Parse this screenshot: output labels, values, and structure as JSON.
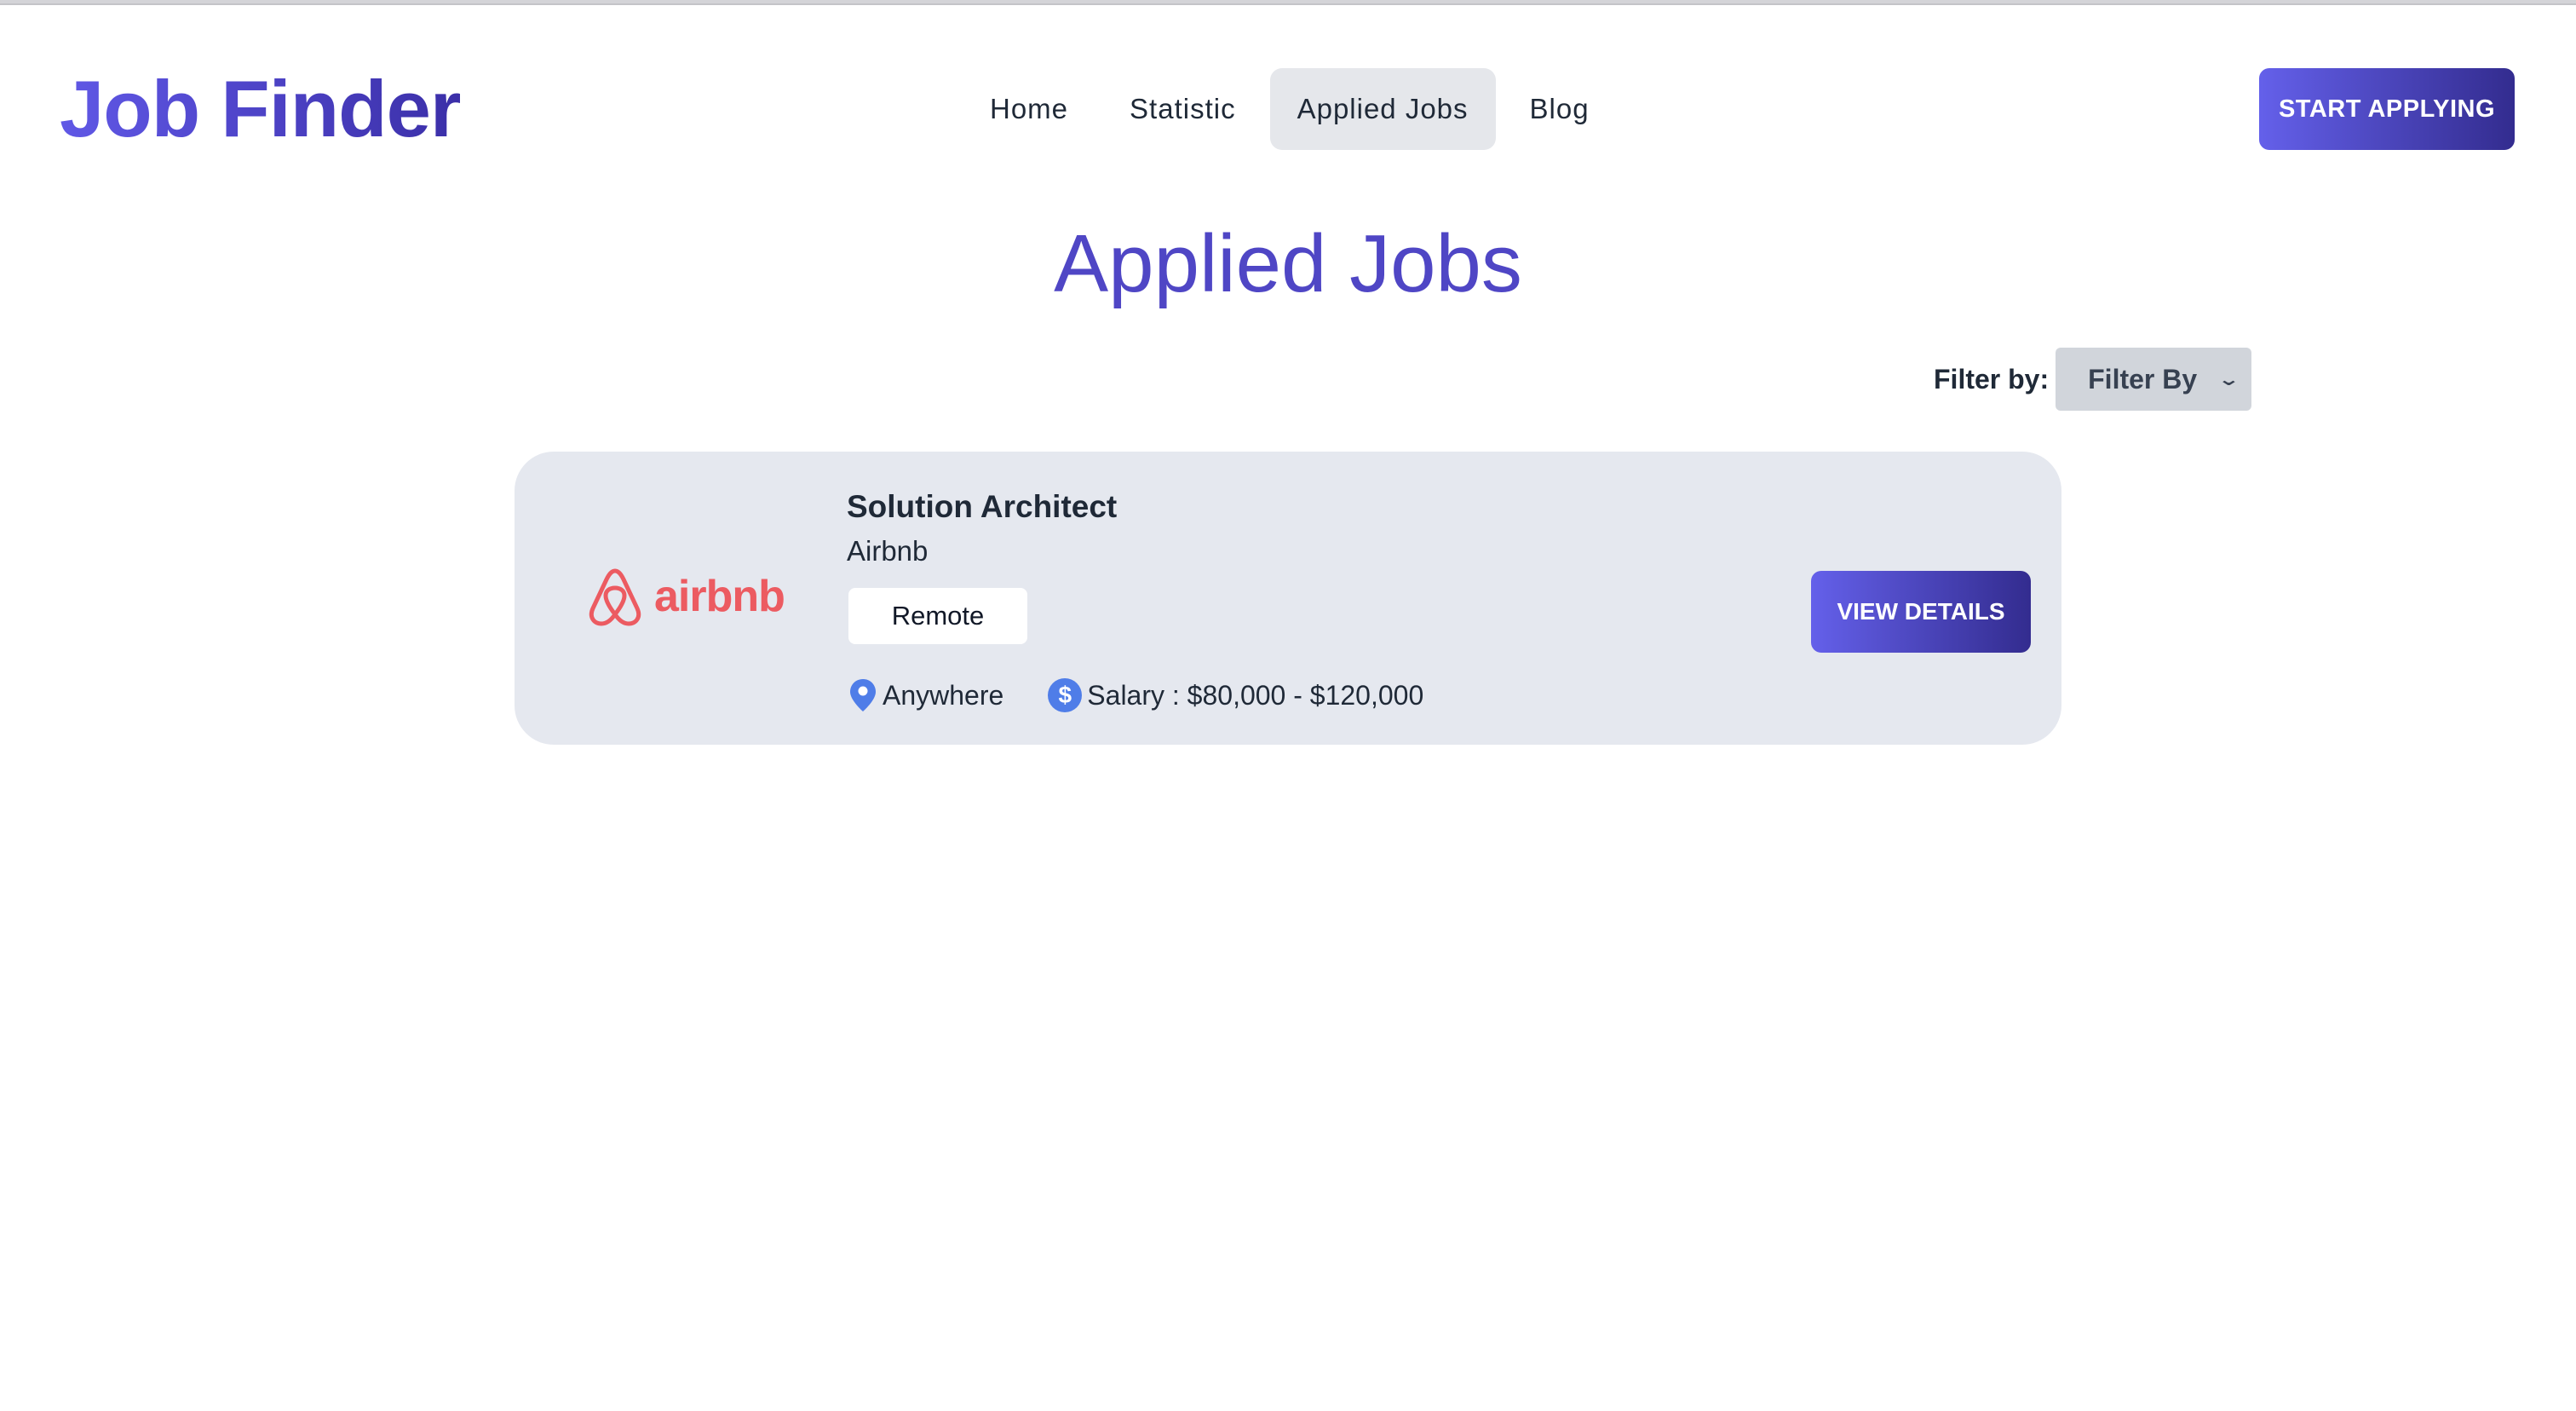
{
  "header": {
    "logo": "Job Finder",
    "nav": [
      {
        "label": "Home"
      },
      {
        "label": "Statistic"
      },
      {
        "label": "Applied Jobs",
        "active": true
      },
      {
        "label": "Blog"
      }
    ],
    "cta_label": "START APPLYING"
  },
  "main": {
    "title": "Applied Jobs",
    "filter": {
      "label": "Filter by:",
      "selected": "Filter By"
    },
    "jobs": [
      {
        "company_logo": "airbnb",
        "title": "Solution Architect",
        "company": "Airbnb",
        "type": "Remote",
        "location": "Anywhere",
        "salary": "Salary : $80,000 - $120,000",
        "button_label": "VIEW DETAILS"
      }
    ]
  },
  "icons": {
    "location": "map-pin-icon",
    "salary": "dollar-icon",
    "filter_chevron": "chevron-down-icon"
  },
  "colors": {
    "brand_gradient_start": "#6460ea",
    "brand_gradient_end": "#332c8f",
    "title": "#4f46c5",
    "card_bg": "#e5e8ef",
    "airbnb": "#ec5b61",
    "location_icon": "#4f7de8"
  }
}
